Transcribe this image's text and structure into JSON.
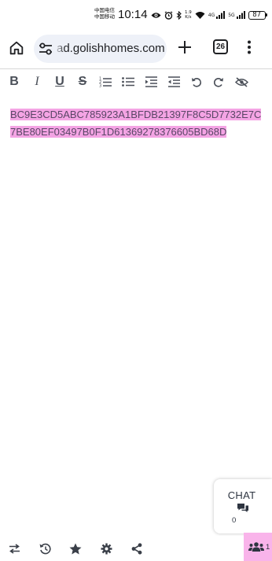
{
  "status_bar": {
    "carrier_line1": "中国电信",
    "carrier_line2": "中国移动",
    "time": "10:14",
    "speed_value": "1.9",
    "speed_unit": "K/s",
    "network_tag_1": "4G",
    "network_tag_2": "5G",
    "battery": "87"
  },
  "browser": {
    "url": "ad.golishhomes.com",
    "tab_count": "26"
  },
  "editor": {
    "format_buttons": [
      "bold",
      "italic",
      "underline",
      "strikethrough",
      "ordered-list",
      "bullet-list",
      "indent",
      "outdent",
      "undo",
      "redo",
      "hide"
    ],
    "bold_label": "B",
    "italic_label": "I",
    "underline_label": "U",
    "strike_label": "S",
    "content_line1": "BC9E3CD5ABC785923A1BFDB21397F8C5D7732E7C",
    "content_line2": "7BE80EF03497B0F1D61369278376605BD68D",
    "highlight_color": "#f4a4e4"
  },
  "chat": {
    "label": "CHAT",
    "icon": "comments-icon",
    "count": "0"
  },
  "bottom_bar": {
    "icons": [
      "swap-icon",
      "history-icon",
      "star-icon",
      "gear-icon",
      "share-icon"
    ],
    "users_count": "1",
    "users_highlight": "#f9b4ea"
  }
}
